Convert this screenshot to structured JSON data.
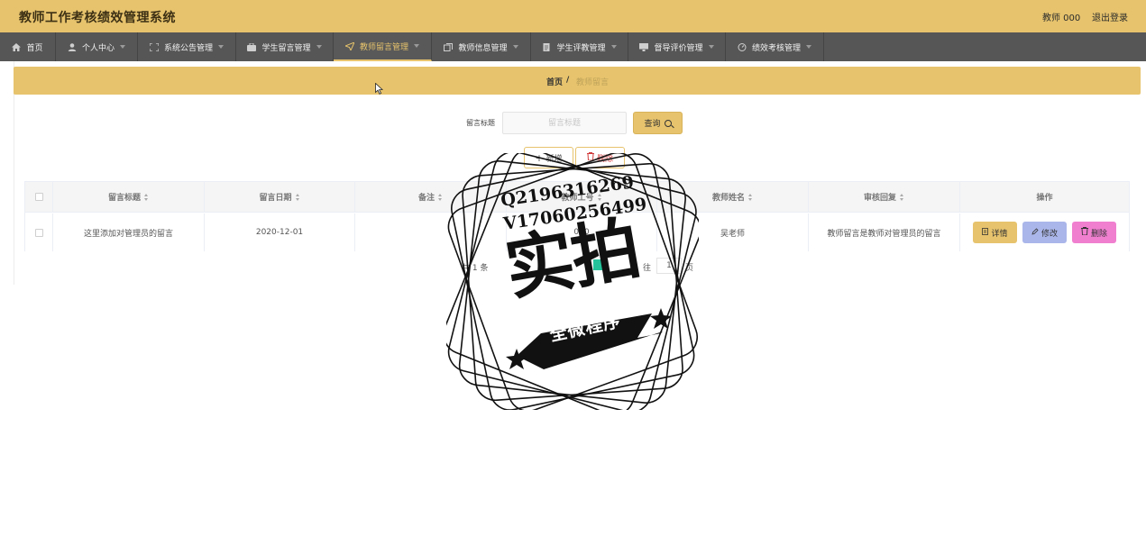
{
  "header": {
    "title": "教师工作考核绩效管理系统",
    "user": "教师 000",
    "logout": "退出登录"
  },
  "nav": {
    "items": [
      {
        "label": "首页",
        "icon": "home-icon",
        "has_caret": false
      },
      {
        "label": "个人中心",
        "icon": "user-icon",
        "has_caret": true
      },
      {
        "label": "系统公告管理",
        "icon": "fullscreen-icon",
        "has_caret": true
      },
      {
        "label": "学生留言管理",
        "icon": "briefcase-icon",
        "has_caret": true
      },
      {
        "label": "教师留言管理",
        "icon": "send-icon",
        "has_caret": true,
        "active": true
      },
      {
        "label": "教师信息管理",
        "icon": "copy-icon",
        "has_caret": true
      },
      {
        "label": "学生评教管理",
        "icon": "document-icon",
        "has_caret": true
      },
      {
        "label": "督导评价管理",
        "icon": "monitor-icon",
        "has_caret": true
      },
      {
        "label": "绩效考核管理",
        "icon": "gauge-icon",
        "has_caret": true
      }
    ]
  },
  "breadcrumb": {
    "home": "首页",
    "separator": "/",
    "current": "教师留言"
  },
  "search": {
    "label": "留言标题",
    "placeholder": "留言标题",
    "button": "查询"
  },
  "actions": {
    "add": "新增",
    "delete": "删除"
  },
  "table": {
    "columns": [
      "留言标题",
      "留言日期",
      "备注",
      "教师工号",
      "教师姓名",
      "审核回复",
      "操作"
    ],
    "rows": [
      {
        "title": "这里添加对管理员的留言",
        "date": "2020-12-01",
        "remark": "",
        "teacher_id": "000",
        "teacher_name": "吴老师",
        "reply": "教师留言是教师对管理员的留言",
        "buttons": [
          "详情",
          "修改",
          "删除"
        ]
      }
    ]
  },
  "pager": {
    "total": "共 1 条",
    "goto": "往",
    "page_value": "1",
    "page_suffix": "页"
  },
  "watermark": {
    "line1": "Q2196316269",
    "line2": "V17060256499",
    "big": "实拍",
    "ribbon": "全微程序"
  },
  "colors": {
    "accent": "#e6c36c",
    "nav_bg": "#565656",
    "edit_btn": "#aab6e9",
    "delete_btn": "#f07fd0",
    "pager_active": "#25c39b"
  }
}
